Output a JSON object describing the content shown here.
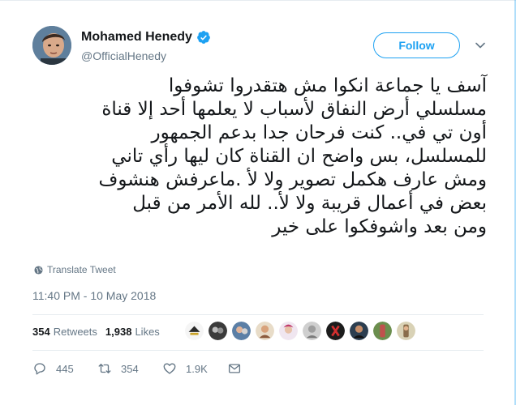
{
  "author": {
    "display_name": "Mohamed Henedy",
    "handle": "@OfficialHenedy",
    "verified": true,
    "follow_label": "Follow"
  },
  "tweet": {
    "lines": [
      "آسف يا جماعة انكوا مش هتقدروا تشوفوا",
      "مسلسلي أرض النفاق لأسباب لا يعلمها أحد إلا قناة",
      "أون تي في.. كنت فرحان جدا بدعم الجمهور",
      "للمسلسل، بس واضح ان القناة كان ليها رأي تاني",
      "ومش عارف هكمل تصوير ولا لأ .ماعرفش هنشوف",
      "بعض في أعمال قريبة ولا لأ.. لله الأمر من قبل",
      "ومن بعد واشوفكوا على خير"
    ],
    "translate_label": "Translate Tweet",
    "timestamp": "11:40 PM - 10 May 2018"
  },
  "stats": {
    "retweets_count": "354",
    "retweets_label": "Retweets",
    "likes_count": "1,938",
    "likes_label": "Likes"
  },
  "actions": {
    "reply_count": "445",
    "retweet_count": "354",
    "like_count": "1.9K"
  },
  "colors": {
    "accent": "#1da1f2",
    "secondary_text": "#657786",
    "primary_text": "#14171a",
    "divider": "#e6ecf0"
  }
}
